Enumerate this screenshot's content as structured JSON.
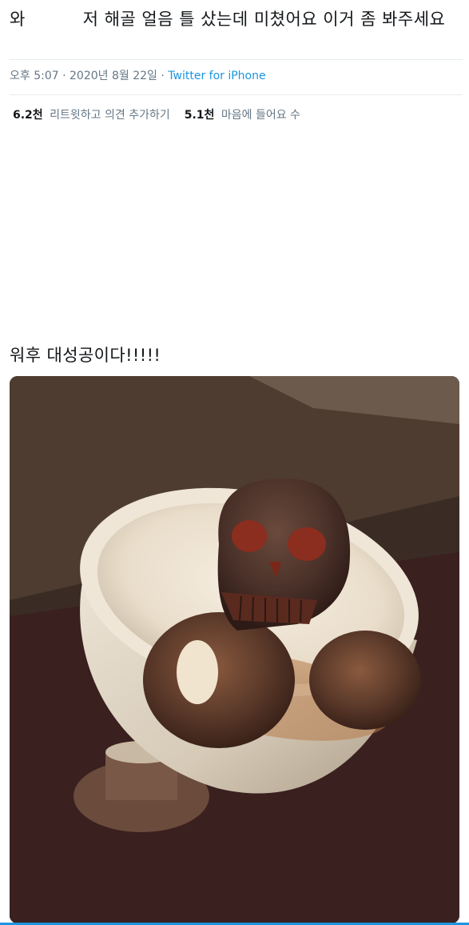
{
  "tweet": {
    "text": "와          저 해골 얼음 틀 샀는데 미쳤어요 이거 좀 봐주세요",
    "time": "오후 5:07",
    "date": "2020년 8월 22일",
    "separator": "·",
    "source": "Twitter for iPhone"
  },
  "stats": {
    "retweets_count": "6.2천",
    "retweets_label": "리트윗하고 의견 추가하기",
    "likes_count": "5.1천",
    "likes_label": "마음에 들어요 수"
  },
  "caption": "워후 대성공이다!!!!!",
  "colors": {
    "link": "#1b95e0",
    "muted": "#657786",
    "text": "#14171a",
    "divider": "#e6ecf0"
  }
}
